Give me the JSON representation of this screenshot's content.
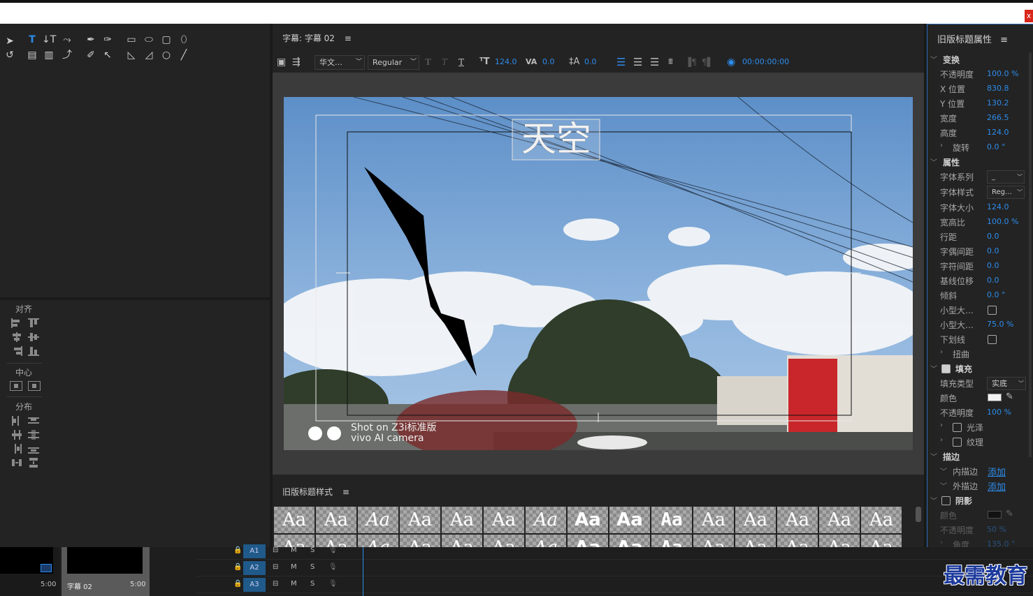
{
  "window": {
    "close_label": "x"
  },
  "align_panel": {
    "align_title": "对齐",
    "center_title": "中心",
    "distribute_title": "分布"
  },
  "center_panel": {
    "title": "字幕: 字幕 02",
    "menu_icon": "≡",
    "toolbar": {
      "font_family": "华文…",
      "font_style": "Regular",
      "font_size": "124.0",
      "kerning": "0.0",
      "leading": "0.0",
      "timecode": "00:00:00:00"
    },
    "video": {
      "title_text": "天空",
      "watermark_line1": "Shot on Z3i标准版",
      "watermark_line2": "vivo AI camera"
    }
  },
  "styles_panel": {
    "title": "旧版标题样式",
    "menu_icon": "≡",
    "swatches": [
      "Aa",
      "Aa",
      "Aa",
      "Aa",
      "Aa",
      "Aa",
      "Aa",
      "Aa",
      "Aa",
      "Aa",
      "Aa",
      "Aa",
      "Aa",
      "Aa",
      "Aa"
    ]
  },
  "right_panel": {
    "title": "旧版标题属性",
    "menu_icon": "≡",
    "transform": {
      "header": "变换",
      "opacity_label": "不透明度",
      "opacity_value": "100.0 %",
      "x_label": "X 位置",
      "x_value": "830.8",
      "y_label": "Y 位置",
      "y_value": "130.2",
      "width_label": "宽度",
      "width_value": "266.5",
      "height_label": "高度",
      "height_value": "124.0",
      "rotation_label": "旋转",
      "rotation_value": "0.0 °"
    },
    "properties": {
      "header": "属性",
      "font_family_label": "字体系列",
      "font_family_value": "_",
      "font_style_label": "字体样式",
      "font_style_value": "Reg…",
      "font_size_label": "字体大小",
      "font_size_value": "124.0",
      "aspect_label": "宽高比",
      "aspect_value": "100.0 %",
      "leading_label": "行距",
      "leading_value": "0.0",
      "kerning_label": "字偶间距",
      "kerning_value": "0.0",
      "tracking_label": "字符间距",
      "tracking_value": "0.0",
      "baseline_label": "基线位移",
      "baseline_value": "0.0",
      "slant_label": "倾斜",
      "slant_value": "0.0 °",
      "smallcaps_label": "小型大…",
      "smallcaps_size_label": "小型大…",
      "smallcaps_size_value": "75.0 %",
      "underline_label": "下划线",
      "distort_label": "扭曲"
    },
    "fill": {
      "header": "填充",
      "type_label": "填充类型",
      "type_value": "实底",
      "color_label": "颜色",
      "color_value": "#f2f2f2",
      "opacity_label": "不透明度",
      "opacity_value": "100 %",
      "sheen_label": "光泽",
      "texture_label": "纹理"
    },
    "stroke": {
      "header": "描边",
      "inner_label": "内描边",
      "inner_action": "添加",
      "outer_label": "外描边",
      "outer_action": "添加"
    },
    "shadow": {
      "header": "阴影",
      "color_label": "颜色",
      "opacity_label": "不透明度",
      "opacity_value": "50 %",
      "angle_label": "角度",
      "angle_value": "135.0 °"
    }
  },
  "timeline": {
    "clip1_time": "5:00",
    "clip2_name": "字幕 02",
    "clip2_time": "5:00",
    "tracks": [
      {
        "name": "A1",
        "m": "M",
        "s": "S"
      },
      {
        "name": "A2",
        "m": "M",
        "s": "S"
      },
      {
        "name": "A3",
        "m": "M",
        "s": "S"
      }
    ]
  },
  "brand_watermark": "最需教育",
  "colors": {
    "accent": "#2d8ceb",
    "panel": "#232323",
    "separator": "#1a1a1a"
  }
}
